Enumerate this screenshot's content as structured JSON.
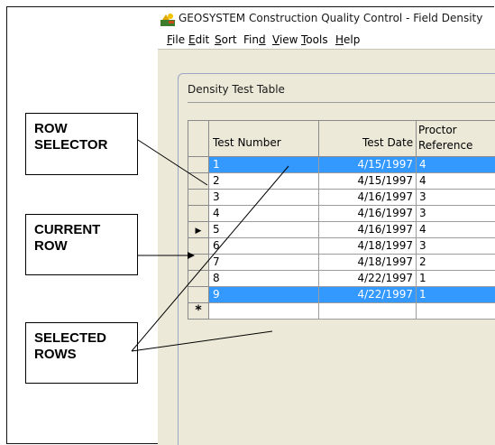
{
  "window": {
    "title": "GEOSYSTEM Construction Quality Control - Field Density"
  },
  "menu": [
    {
      "label": "File",
      "accel": "F"
    },
    {
      "label": "Edit",
      "accel": "E"
    },
    {
      "label": "Sort",
      "accel": "S"
    },
    {
      "label": "Find",
      "accel": "d"
    },
    {
      "label": "View",
      "accel": "V"
    },
    {
      "label": "Tools",
      "accel": "T"
    },
    {
      "label": "Help",
      "accel": "H"
    }
  ],
  "form": {
    "title": "Density Test Table"
  },
  "table": {
    "columns": {
      "test_number": "Test Number",
      "test_date": "Test Date",
      "proctor_line1": "Proctor",
      "proctor_line2": "Reference"
    },
    "rows": [
      {
        "test_number": "1",
        "test_date": "4/15/1997",
        "proctor": "4",
        "selected": true,
        "current": false
      },
      {
        "test_number": "2",
        "test_date": "4/15/1997",
        "proctor": "4",
        "selected": false,
        "current": false
      },
      {
        "test_number": "3",
        "test_date": "4/16/1997",
        "proctor": "3",
        "selected": false,
        "current": false
      },
      {
        "test_number": "4",
        "test_date": "4/16/1997",
        "proctor": "3",
        "selected": false,
        "current": false
      },
      {
        "test_number": "5",
        "test_date": "4/16/1997",
        "proctor": "4",
        "selected": false,
        "current": true
      },
      {
        "test_number": "6",
        "test_date": "4/18/1997",
        "proctor": "3",
        "selected": false,
        "current": false
      },
      {
        "test_number": "7",
        "test_date": "4/18/1997",
        "proctor": "2",
        "selected": false,
        "current": false
      },
      {
        "test_number": "8",
        "test_date": "4/22/1997",
        "proctor": "1",
        "selected": false,
        "current": false
      },
      {
        "test_number": "9",
        "test_date": "4/22/1997",
        "proctor": "1",
        "selected": true,
        "current": false
      }
    ],
    "new_row_marker": "*",
    "current_row_marker": "▶"
  },
  "callouts": {
    "row_selector": "ROW\nSELECTOR",
    "current_row": "CURRENT\nROW",
    "selected_rows": "SELECTED\nROWS"
  },
  "colors": {
    "selection": "#3399ff",
    "window_bg": "#ece9d8"
  },
  "icons": {
    "app": "geosystem-app-icon"
  }
}
